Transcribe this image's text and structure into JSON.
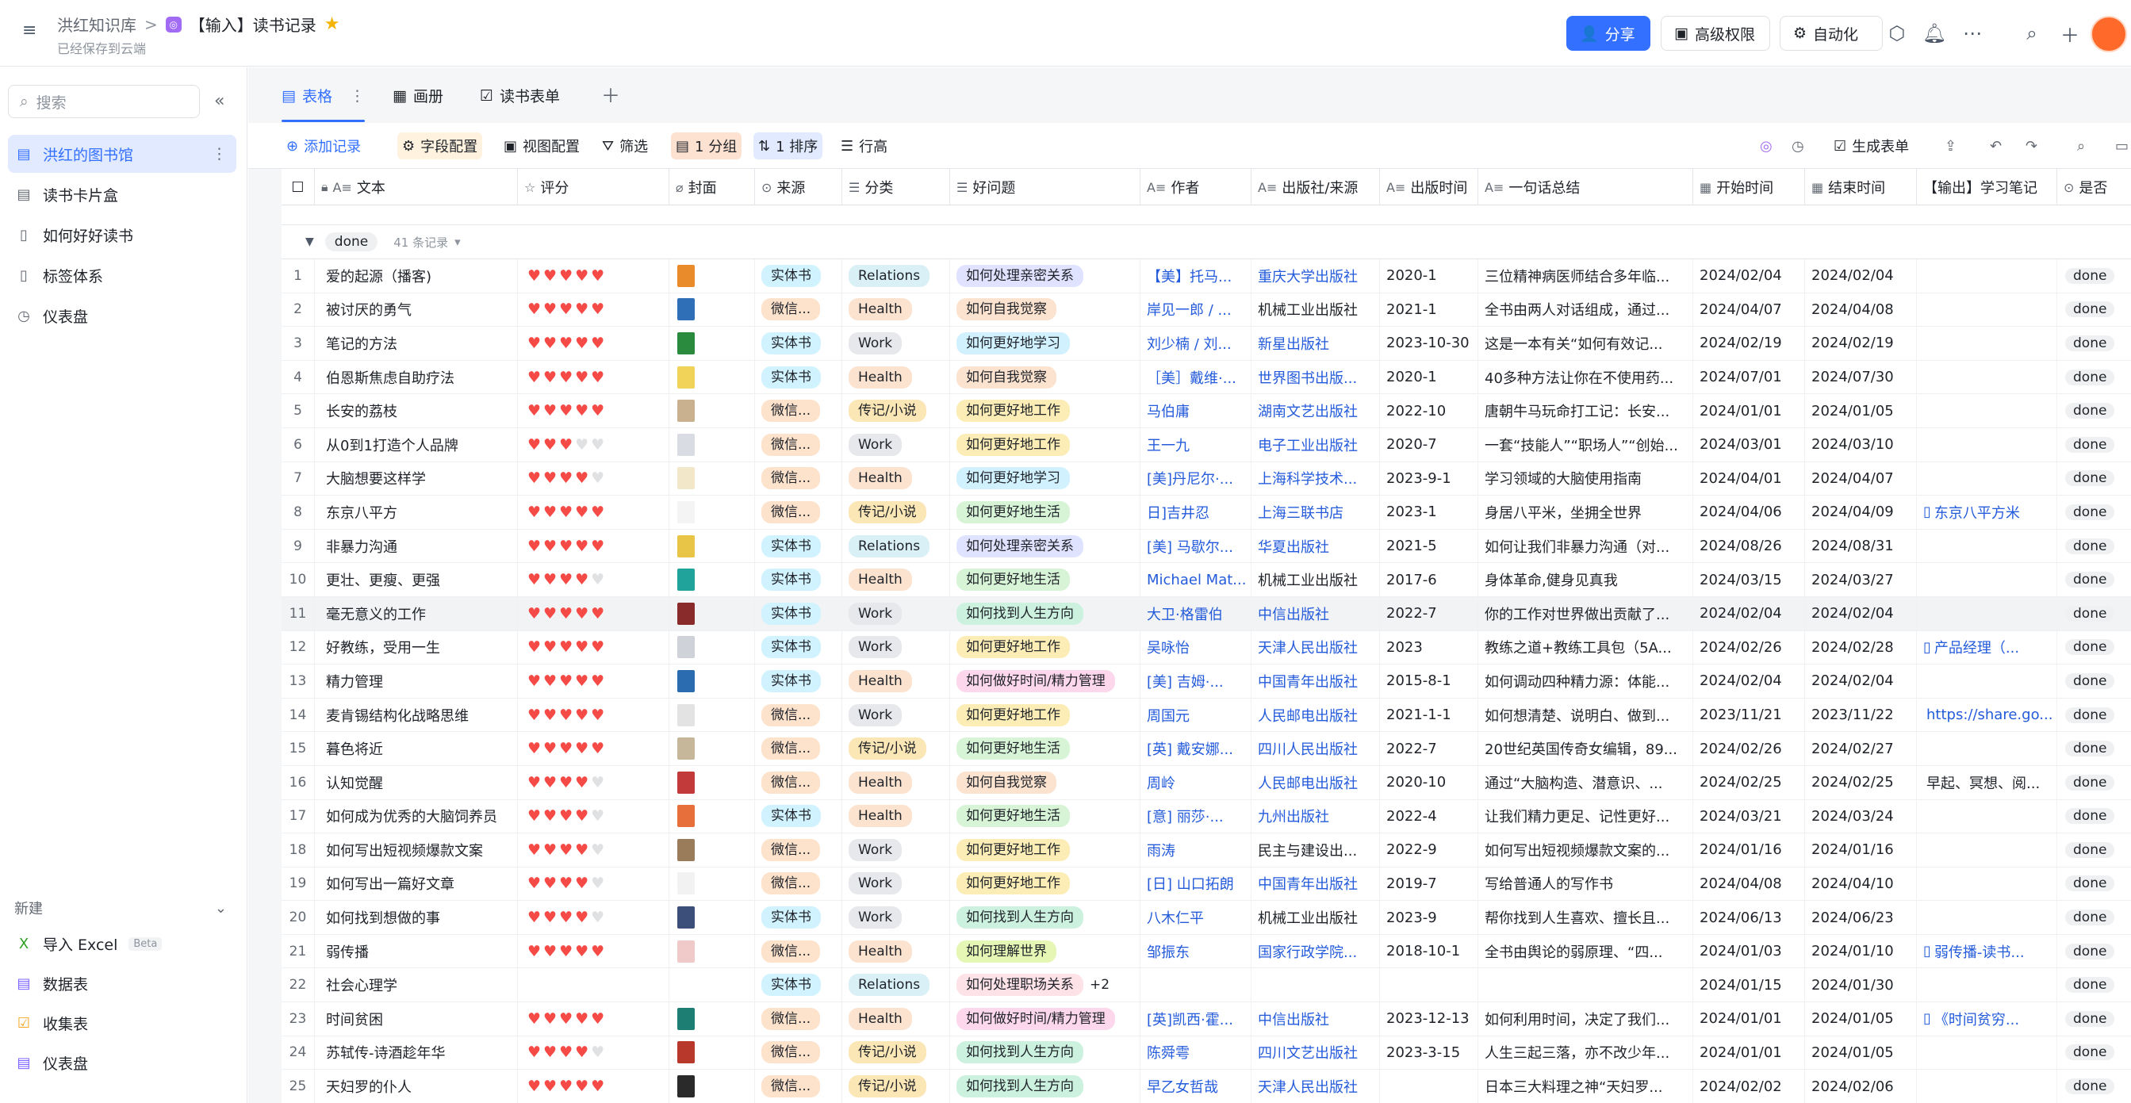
{
  "topbar": {
    "breadcrumb_root": "洪红知识库",
    "breadcrumb_sep": ">",
    "app_icon": "base-app-icon",
    "doc_title": "【输入】读书记录",
    "saved_status": "已经保存到云端",
    "share_label": "分享",
    "advanced_perm_label": "高级权限",
    "automation_label": "自动化"
  },
  "sidebar": {
    "search_placeholder": "搜索",
    "items": [
      {
        "label": "洪红的图书馆",
        "icon": "table-icon",
        "active": true
      },
      {
        "label": "读书卡片盒",
        "icon": "table-icon"
      },
      {
        "label": "如何好好读书",
        "icon": "doc-icon"
      },
      {
        "label": "标签体系",
        "icon": "doc-icon"
      },
      {
        "label": "仪表盘",
        "icon": "dashboard-icon"
      }
    ],
    "new_section": {
      "title": "新建",
      "items": [
        {
          "label": "导入 Excel",
          "badge": "Beta",
          "icon": "excel-icon"
        },
        {
          "label": "数据表",
          "icon": "table-icon"
        },
        {
          "label": "收集表",
          "icon": "form-icon"
        },
        {
          "label": "仪表盘",
          "icon": "dashboard-icon"
        }
      ]
    }
  },
  "views": {
    "tabs": [
      {
        "label": "表格",
        "active": true
      },
      {
        "label": "画册"
      },
      {
        "label": "读书表单"
      }
    ]
  },
  "toolbar": {
    "add_record": "添加记录",
    "field_config": "字段配置",
    "view_config": "视图配置",
    "filter": "筛选",
    "group": "1 分组",
    "sort": "1 排序",
    "row_height": "行高",
    "generate_form": "生成表单"
  },
  "columns": [
    "文本",
    "评分",
    "封面",
    "来源",
    "分类",
    "好问题",
    "作者",
    "出版社/来源",
    "出版时间",
    "一句话总结",
    "开始时间",
    "结束时间",
    "【输出】学习笔记",
    "是否"
  ],
  "group": {
    "value": "done",
    "count_label": "41 条记录"
  },
  "colors": {
    "accent": "#3370ff",
    "heart": "#f54a45"
  },
  "rows": [
    {
      "n": "1",
      "title": "爱的起源（播客)",
      "rating": 5,
      "cover": "#e98b2a",
      "source": "实体书",
      "cat": "Relations",
      "q": "如何处理亲密关系",
      "author": "【美】托马...",
      "pub": "重庆大学出版社",
      "date": "2020-1",
      "summary": "三位精神病医师结合多年临...",
      "start": "2024/02/04",
      "end": "2024/02/04",
      "note": "",
      "status": "done"
    },
    {
      "n": "2",
      "title": "被讨厌的勇气",
      "rating": 5,
      "cover": "#2f6fb7",
      "source": "微信...",
      "cat": "Health",
      "q": "如何自我觉察",
      "author": "岸见一郎 / ...",
      "pub": "机械工业出版社",
      "date": "2021-1",
      "summary": "全书由两人对话组成，通过...",
      "start": "2024/04/07",
      "end": "2024/04/08",
      "note": "",
      "status": "done"
    },
    {
      "n": "3",
      "title": "笔记的方法",
      "rating": 5,
      "cover": "#2a8a3e",
      "source": "实体书",
      "cat": "Work",
      "q": "如何更好地学习",
      "author": "刘少楠 / 刘...",
      "pub": "新星出版社",
      "date": "2023-10-30",
      "summary": "这是一本有关“如何有效记...",
      "start": "2024/02/19",
      "end": "2024/02/19",
      "note": "",
      "status": "done"
    },
    {
      "n": "4",
      "title": "伯恩斯焦虑自助疗法",
      "rating": 5,
      "cover": "#f2d35a",
      "source": "实体书",
      "cat": "Health",
      "q": "如何自我觉察",
      "author": "［美］戴维·...",
      "pub": "世界图书出版...",
      "date": "2020-1",
      "summary": "40多种方法让你在不使用药...",
      "start": "2024/07/01",
      "end": "2024/07/30",
      "note": "",
      "status": "done"
    },
    {
      "n": "5",
      "title": "长安的荔枝",
      "rating": 5,
      "cover": "#c9b18f",
      "source": "微信...",
      "cat": "传记/小说",
      "q": "如何更好地工作",
      "author": "马伯庸",
      "pub": "湖南文艺出版社",
      "date": "2022-10",
      "summary": "唐朝牛马玩命打工记：长安...",
      "start": "2024/01/01",
      "end": "2024/01/05",
      "note": "",
      "status": "done"
    },
    {
      "n": "6",
      "title": "从0到1打造个人品牌",
      "rating": 3,
      "cover": "#d9dde3",
      "source": "微信...",
      "cat": "Work",
      "q": "如何更好地工作",
      "author": "王一九",
      "pub": "电子工业出版社",
      "date": "2020-7",
      "summary": "一套“技能人”“职场人”“创始...",
      "start": "2024/03/01",
      "end": "2024/03/10",
      "note": "",
      "status": "done"
    },
    {
      "n": "7",
      "title": "大脑想要这样学",
      "rating": 4,
      "cover": "#f3e7c9",
      "source": "微信...",
      "cat": "Health",
      "q": "如何更好地学习",
      "author": "[美]丹尼尔·...",
      "pub": "上海科学技术...",
      "date": "2023-9-1",
      "summary": "学习领域的大脑使用指南",
      "start": "2024/04/01",
      "end": "2024/04/07",
      "note": "",
      "status": "done"
    },
    {
      "n": "8",
      "title": "东京八平方",
      "rating": 5,
      "cover": "#f4f4f4",
      "source": "微信...",
      "cat": "传记/小说",
      "q": "如何更好地生活",
      "author": "日]吉井忍",
      "pub": "上海三联书店",
      "date": "2023-1",
      "summary": "身居八平米，坐拥全世界",
      "start": "2024/04/06",
      "end": "2024/04/09",
      "note": "东京八平方米",
      "status": "done"
    },
    {
      "n": "9",
      "title": "非暴力沟通",
      "rating": 5,
      "cover": "#e8c547",
      "source": "实体书",
      "cat": "Relations",
      "q": "如何处理亲密关系",
      "author": "[美] 马歇尔...",
      "pub": "华夏出版社",
      "date": "2021-5",
      "summary": "如何让我们非暴力沟通（对...",
      "start": "2024/08/26",
      "end": "2024/08/31",
      "note": "",
      "status": "done"
    },
    {
      "n": "10",
      "title": "更壮、更瘦、更强",
      "rating": 4,
      "cover": "#1fa39a",
      "source": "实体书",
      "cat": "Health",
      "q": "如何更好地生活",
      "author": "Michael Mat...",
      "pub": "机械工业出版社",
      "date": "2017-6",
      "summary": "身体革命,健身见真我",
      "start": "2024/03/15",
      "end": "2024/03/27",
      "note": "",
      "status": "done"
    },
    {
      "n": "11",
      "title": "毫无意义的工作",
      "rating": 5,
      "cover": "#8a2b2b",
      "source": "实体书",
      "cat": "Work",
      "q": "如何找到人生方向",
      "author": "大卫·格雷伯",
      "pub": "中信出版社",
      "date": "2022-7",
      "summary": "你的工作对世界做出贡献了...",
      "start": "2024/02/04",
      "end": "2024/02/04",
      "note": "",
      "status": "done"
    },
    {
      "n": "12",
      "title": "好教练，受用一生",
      "rating": 5,
      "cover": "#cfd3d9",
      "source": "实体书",
      "cat": "Work",
      "q": "如何更好地工作",
      "author": "吴咏怡",
      "pub": "天津人民出版社",
      "date": "2023",
      "summary": "教练之道+教练工具包（5A...",
      "start": "2024/02/26",
      "end": "2024/02/28",
      "note": "产品经理（...",
      "status": "done"
    },
    {
      "n": "13",
      "title": "精力管理",
      "rating": 5,
      "cover": "#2b6cb0",
      "source": "实体书",
      "cat": "Health",
      "q": "如何做好时间/精力管理",
      "author": "[美] 吉姆·...",
      "pub": "中国青年出版社",
      "date": "2015-8-1",
      "summary": "如何调动四种精力源：体能...",
      "start": "2024/02/04",
      "end": "2024/02/04",
      "note": "",
      "status": "done"
    },
    {
      "n": "14",
      "title": "麦肯锡结构化战略思维",
      "rating": 5,
      "cover": "#e3e3e3",
      "source": "微信...",
      "cat": "Work",
      "q": "如何更好地工作",
      "author": "周国元",
      "pub": "人民邮电出版社",
      "date": "2021-1-1",
      "summary": "如何想清楚、说明白、做到...",
      "start": "2023/11/21",
      "end": "2023/11/22",
      "note": "https://share.go...",
      "status": "done"
    },
    {
      "n": "15",
      "title": "暮色将近",
      "rating": 5,
      "cover": "#c7b79a",
      "source": "微信...",
      "cat": "传记/小说",
      "q": "如何更好地生活",
      "author": "[英] 戴安娜...",
      "pub": "四川人民出版社",
      "date": "2022-7",
      "summary": "20世纪英国传奇女编辑，89...",
      "start": "2024/02/26",
      "end": "2024/02/27",
      "note": "",
      "status": "done"
    },
    {
      "n": "16",
      "title": "认知觉醒",
      "rating": 4,
      "cover": "#c23a3a",
      "source": "微信...",
      "cat": "Health",
      "q": "如何自我觉察",
      "author": "周岭",
      "pub": "人民邮电出版社",
      "date": "2020-10",
      "summary": "通过“大脑构造、潜意识、...",
      "start": "2024/02/25",
      "end": "2024/02/25",
      "note": "早起、冥想、阅...",
      "status": "done"
    },
    {
      "n": "17",
      "title": "如何成为优秀的大脑饲养员",
      "rating": 4,
      "cover": "#e76f3c",
      "source": "实体书",
      "cat": "Health",
      "q": "如何更好地生活",
      "author": "[意] 丽莎·...",
      "pub": "九州出版社",
      "date": "2022-4",
      "summary": "让我们精力更足、记性更好...",
      "start": "2024/03/21",
      "end": "2024/03/24",
      "note": "",
      "status": "done"
    },
    {
      "n": "18",
      "title": "如何写出短视频爆款文案",
      "rating": 4,
      "cover": "#9a7b5a",
      "source": "微信...",
      "cat": "Work",
      "q": "如何更好地工作",
      "author": "雨涛",
      "pub": "民主与建设出...",
      "date": "2022-9",
      "summary": "如何写出短视频爆款文案的...",
      "start": "2024/01/16",
      "end": "2024/01/16",
      "note": "",
      "status": "done"
    },
    {
      "n": "19",
      "title": "如何写出一篇好文章",
      "rating": 4,
      "cover": "#f2f2f2",
      "source": "微信...",
      "cat": "Work",
      "q": "如何更好地工作",
      "author": "[日] 山口拓朗",
      "pub": "中国青年出版社",
      "date": "2019-7",
      "summary": "写给普通人的写作书",
      "start": "2024/04/08",
      "end": "2024/04/10",
      "note": "",
      "status": "done"
    },
    {
      "n": "20",
      "title": "如何找到想做的事",
      "rating": 4,
      "cover": "#3b4f7a",
      "source": "实体书",
      "cat": "Work",
      "q": "如何找到人生方向",
      "author": "八木仁平",
      "pub": "机械工业出版社",
      "date": "2023-9",
      "summary": "帮你找到人生喜欢、擅长且...",
      "start": "2024/06/13",
      "end": "2024/06/23",
      "note": "",
      "status": "done"
    },
    {
      "n": "21",
      "title": "弱传播",
      "rating": 5,
      "cover": "#f0c9c9",
      "source": "微信...",
      "cat": "Health",
      "q": "如何理解世界",
      "author": "邹振东",
      "pub": "国家行政学院...",
      "date": "2018-10-1",
      "summary": "全书由舆论的弱原理、“四...",
      "start": "2024/01/03",
      "end": "2024/01/10",
      "note": "弱传播-读书...",
      "status": "done"
    },
    {
      "n": "22",
      "title": "社会心理学",
      "rating": 0,
      "cover": "",
      "source": "实体书",
      "cat": "Relations",
      "q": "如何处理职场关系",
      "q_extra": "+2",
      "author": "",
      "pub": "",
      "date": "",
      "summary": "",
      "start": "2024/01/15",
      "end": "2024/01/30",
      "note": "",
      "status": "done"
    },
    {
      "n": "23",
      "title": "时间贫困",
      "rating": 5,
      "cover": "#1d7f74",
      "source": "微信...",
      "cat": "Health",
      "q": "如何做好时间/精力管理",
      "author": "[英]凯西·霍...",
      "pub": "中信出版社",
      "date": "2023-12-13",
      "summary": "如何利用时间，决定了我们...",
      "start": "2024/01/01",
      "end": "2024/01/05",
      "note": "《时间贫穷...",
      "status": "done"
    },
    {
      "n": "24",
      "title": "苏轼传-诗酒趁年华",
      "rating": 4,
      "cover": "#b8382c",
      "source": "微信...",
      "cat": "传记/小说",
      "q": "如何找到人生方向",
      "author": "陈舜雩",
      "pub": "四川文艺出版社",
      "date": "2023-3-15",
      "summary": "人生三起三落，亦不改少年...",
      "start": "2024/01/01",
      "end": "2024/01/05",
      "note": "",
      "status": "done"
    },
    {
      "n": "25",
      "title": "天妇罗的仆人",
      "rating": 5,
      "cover": "#2a2a2a",
      "source": "微信...",
      "cat": "传记/小说",
      "q": "如何找到人生方向",
      "author": "早乙女哲哉",
      "pub": "天津人民出版社",
      "date": "",
      "summary": "日本三大料理之神“天妇罗...",
      "start": "2024/02/02",
      "end": "2024/02/06",
      "note": "",
      "status": "done"
    }
  ]
}
